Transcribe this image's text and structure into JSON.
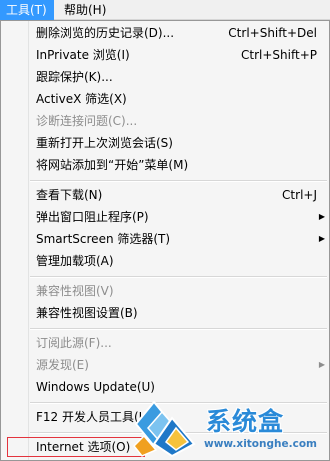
{
  "menubar": [
    {
      "label": "工具(T)",
      "selected": true
    },
    {
      "label": "帮助(H)",
      "selected": false
    }
  ],
  "menu": {
    "items": [
      {
        "label": "删除浏览的历史记录(D)...",
        "shortcut": "Ctrl+Shift+Del",
        "disabled": false
      },
      {
        "label": "InPrivate 浏览(I)",
        "shortcut": "Ctrl+Shift+P",
        "disabled": false
      },
      {
        "label": "跟踪保护(K)...",
        "disabled": false
      },
      {
        "label": "ActiveX 筛选(X)",
        "disabled": false
      },
      {
        "label": "诊断连接问题(C)...",
        "disabled": true
      },
      {
        "label": "重新打开上次浏览会话(S)",
        "disabled": false
      },
      {
        "label": "将网站添加到“开始”菜单(M)",
        "disabled": false
      },
      {
        "label": "查看下载(N)",
        "shortcut": "Ctrl+J",
        "disabled": false
      },
      {
        "label": "弹出窗口阻止程序(P)",
        "submenu": true,
        "disabled": false
      },
      {
        "label": "SmartScreen 筛选器(T)",
        "submenu": true,
        "disabled": false
      },
      {
        "label": "管理加载项(A)",
        "disabled": false
      },
      {
        "label": "兼容性视图(V)",
        "disabled": true
      },
      {
        "label": "兼容性视图设置(B)",
        "disabled": false
      },
      {
        "label": "订阅此源(F)...",
        "disabled": true
      },
      {
        "label": "源发现(E)",
        "submenu": true,
        "disabled": true
      },
      {
        "label": "Windows Update(U)",
        "disabled": false
      },
      {
        "label": "F12 开发人员工具(L)",
        "disabled": false
      },
      {
        "label": "Internet 选项(O)",
        "disabled": false,
        "focused": true
      }
    ]
  },
  "watermark": {
    "title": "系统盒",
    "url": "www.xitonghe.com"
  },
  "colors": {
    "menubar_selected": "#3399ff",
    "disabled_text": "#8d8d8d",
    "focus_outline": "#e3333d",
    "watermark_blue": "#2a8ad8"
  }
}
